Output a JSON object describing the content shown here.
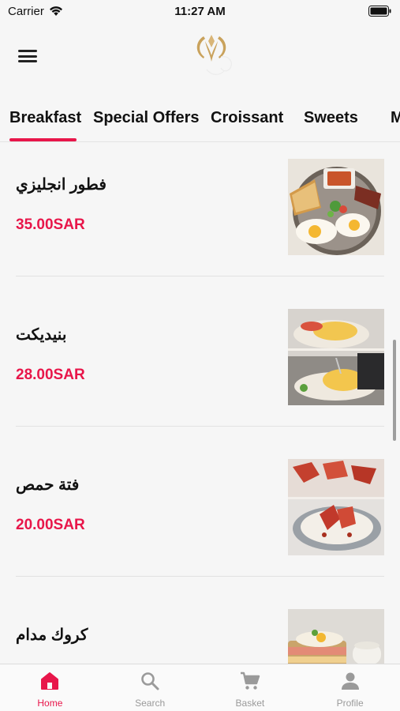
{
  "status_bar": {
    "carrier": "Carrier",
    "time": "11:27 AM"
  },
  "colors": {
    "accent": "#e8164a",
    "logo_gold": "#c9a25c"
  },
  "tabs": [
    {
      "label": "Breakfast",
      "active": true
    },
    {
      "label": "Special Offers",
      "active": false
    },
    {
      "label": "Croissant",
      "active": false
    },
    {
      "label": "Sweets",
      "active": false
    },
    {
      "label": "M",
      "active": false
    }
  ],
  "menu_items": [
    {
      "name": "فطور انجليزي",
      "price": "35.00SAR",
      "image": "english-breakfast-photo"
    },
    {
      "name": "بنيديكت",
      "price": "28.00SAR",
      "image": "eggs-benedict-photo"
    },
    {
      "name": "فتة حمص",
      "price": "20.00SAR",
      "image": "hummus-fatteh-photo"
    },
    {
      "name": "كروك مدام",
      "price": "",
      "image": "croque-madame-photo"
    }
  ],
  "bottom_nav": [
    {
      "label": "Home",
      "icon": "home-icon",
      "active": true
    },
    {
      "label": "Search",
      "icon": "search-icon",
      "active": false
    },
    {
      "label": "Basket",
      "icon": "cart-icon",
      "active": false
    },
    {
      "label": "Profile",
      "icon": "person-icon",
      "active": false
    }
  ]
}
